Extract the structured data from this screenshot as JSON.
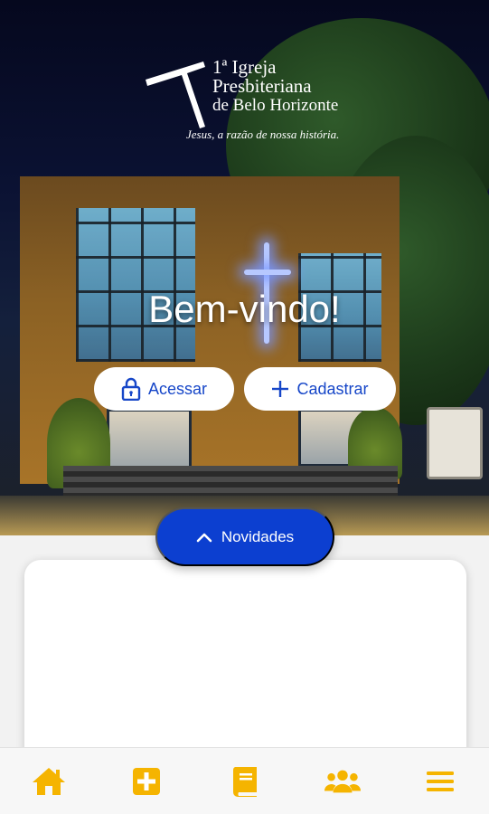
{
  "header": {
    "church_name_lines": [
      "1ª Igreja",
      "Presbiteriana",
      "de Belo Horizonte"
    ],
    "tagline": "Jesus, a razão de nossa história."
  },
  "hero": {
    "welcome": "Bem-vindo!",
    "access_label": "Acessar",
    "register_label": "Cadastrar"
  },
  "news": {
    "label": "Novidades"
  },
  "bottom_nav": {
    "items": [
      {
        "icon": "home-icon"
      },
      {
        "icon": "plus-square-icon"
      },
      {
        "icon": "book-icon"
      },
      {
        "icon": "users-icon"
      },
      {
        "icon": "menu-icon"
      }
    ]
  },
  "colors": {
    "primary_blue": "#0c3fd0",
    "accent_yellow": "#f5b400",
    "white": "#ffffff"
  }
}
